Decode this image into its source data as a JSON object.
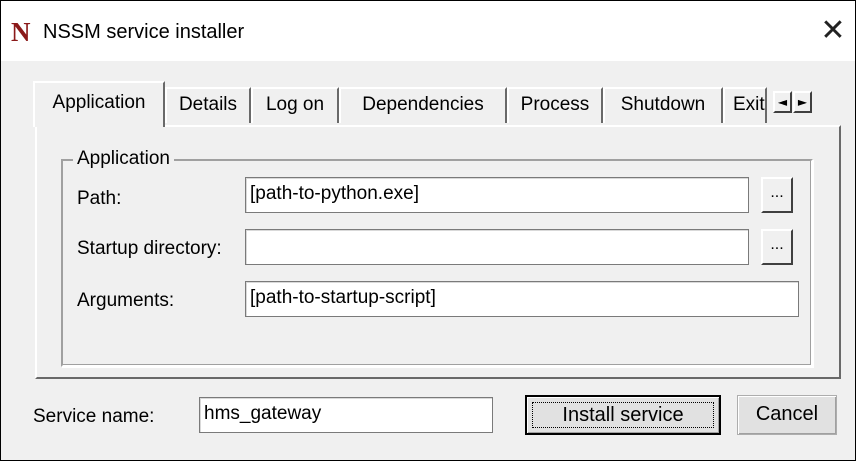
{
  "window": {
    "title": "NSSM service installer",
    "icon_glyph": "N",
    "close_glyph": "✕"
  },
  "tabs": [
    {
      "label": "Application",
      "active": true
    },
    {
      "label": "Details",
      "active": false
    },
    {
      "label": "Log on",
      "active": false
    },
    {
      "label": "Dependencies",
      "active": false
    },
    {
      "label": "Process",
      "active": false
    },
    {
      "label": "Shutdown",
      "active": false
    },
    {
      "label": "Exit",
      "active": false
    }
  ],
  "tab_scroll": {
    "left_glyph": "◄",
    "right_glyph": "►"
  },
  "application_group": {
    "legend": "Application",
    "path_label": "Path:",
    "path_value": "[path-to-python.exe]",
    "startup_label": "Startup directory:",
    "startup_value": "",
    "arguments_label": "Arguments:",
    "arguments_value": "[path-to-startup-script]",
    "browse_label": "..."
  },
  "footer": {
    "service_name_label": "Service name:",
    "service_name_value": "hms_gateway",
    "install_button": "Install service",
    "cancel_button": "Cancel"
  }
}
